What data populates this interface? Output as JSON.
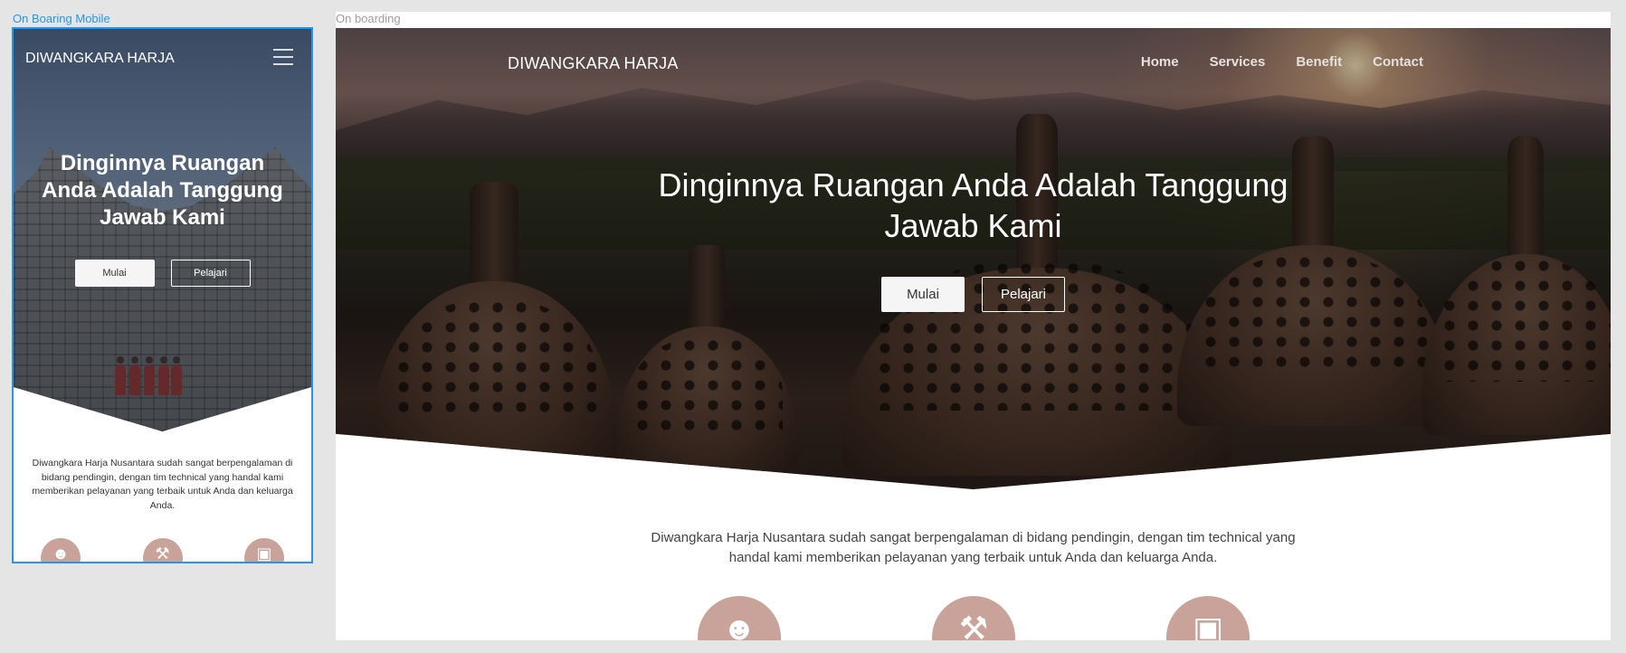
{
  "canvas": {
    "frames": [
      {
        "label": "On Boaring Mobile",
        "selected": true,
        "accent": "#2196f3"
      },
      {
        "label": "On boarding",
        "selected": false
      }
    ]
  },
  "site": {
    "brand": "DIWANGKARA HARJA",
    "nav": [
      "Home",
      "Services",
      "Benefit",
      "Contact"
    ],
    "hero": {
      "title_line1": "Dinginnya Ruangan Anda Adalah Tanggung",
      "title_line2": "Jawab Kami",
      "title_full": "Dinginnya Ruangan Anda Adalah Tanggung Jawab Kami",
      "primary_button": "Mulai",
      "secondary_button": "Pelajari"
    },
    "intro": "Diwangkara Harja Nusantara sudah sangat berpengalaman di bidang pendingin, dengan tim technical yang handal kami memberikan pelayanan yang terbaik untuk Anda dan keluarga Anda.",
    "features": [
      {
        "icon": "user-plus-icon"
      },
      {
        "icon": "tools-icon"
      },
      {
        "icon": "toolbox-icon"
      }
    ],
    "colors": {
      "feature_circle": "#c9a39a",
      "button_light": "#f5f5f5"
    }
  }
}
